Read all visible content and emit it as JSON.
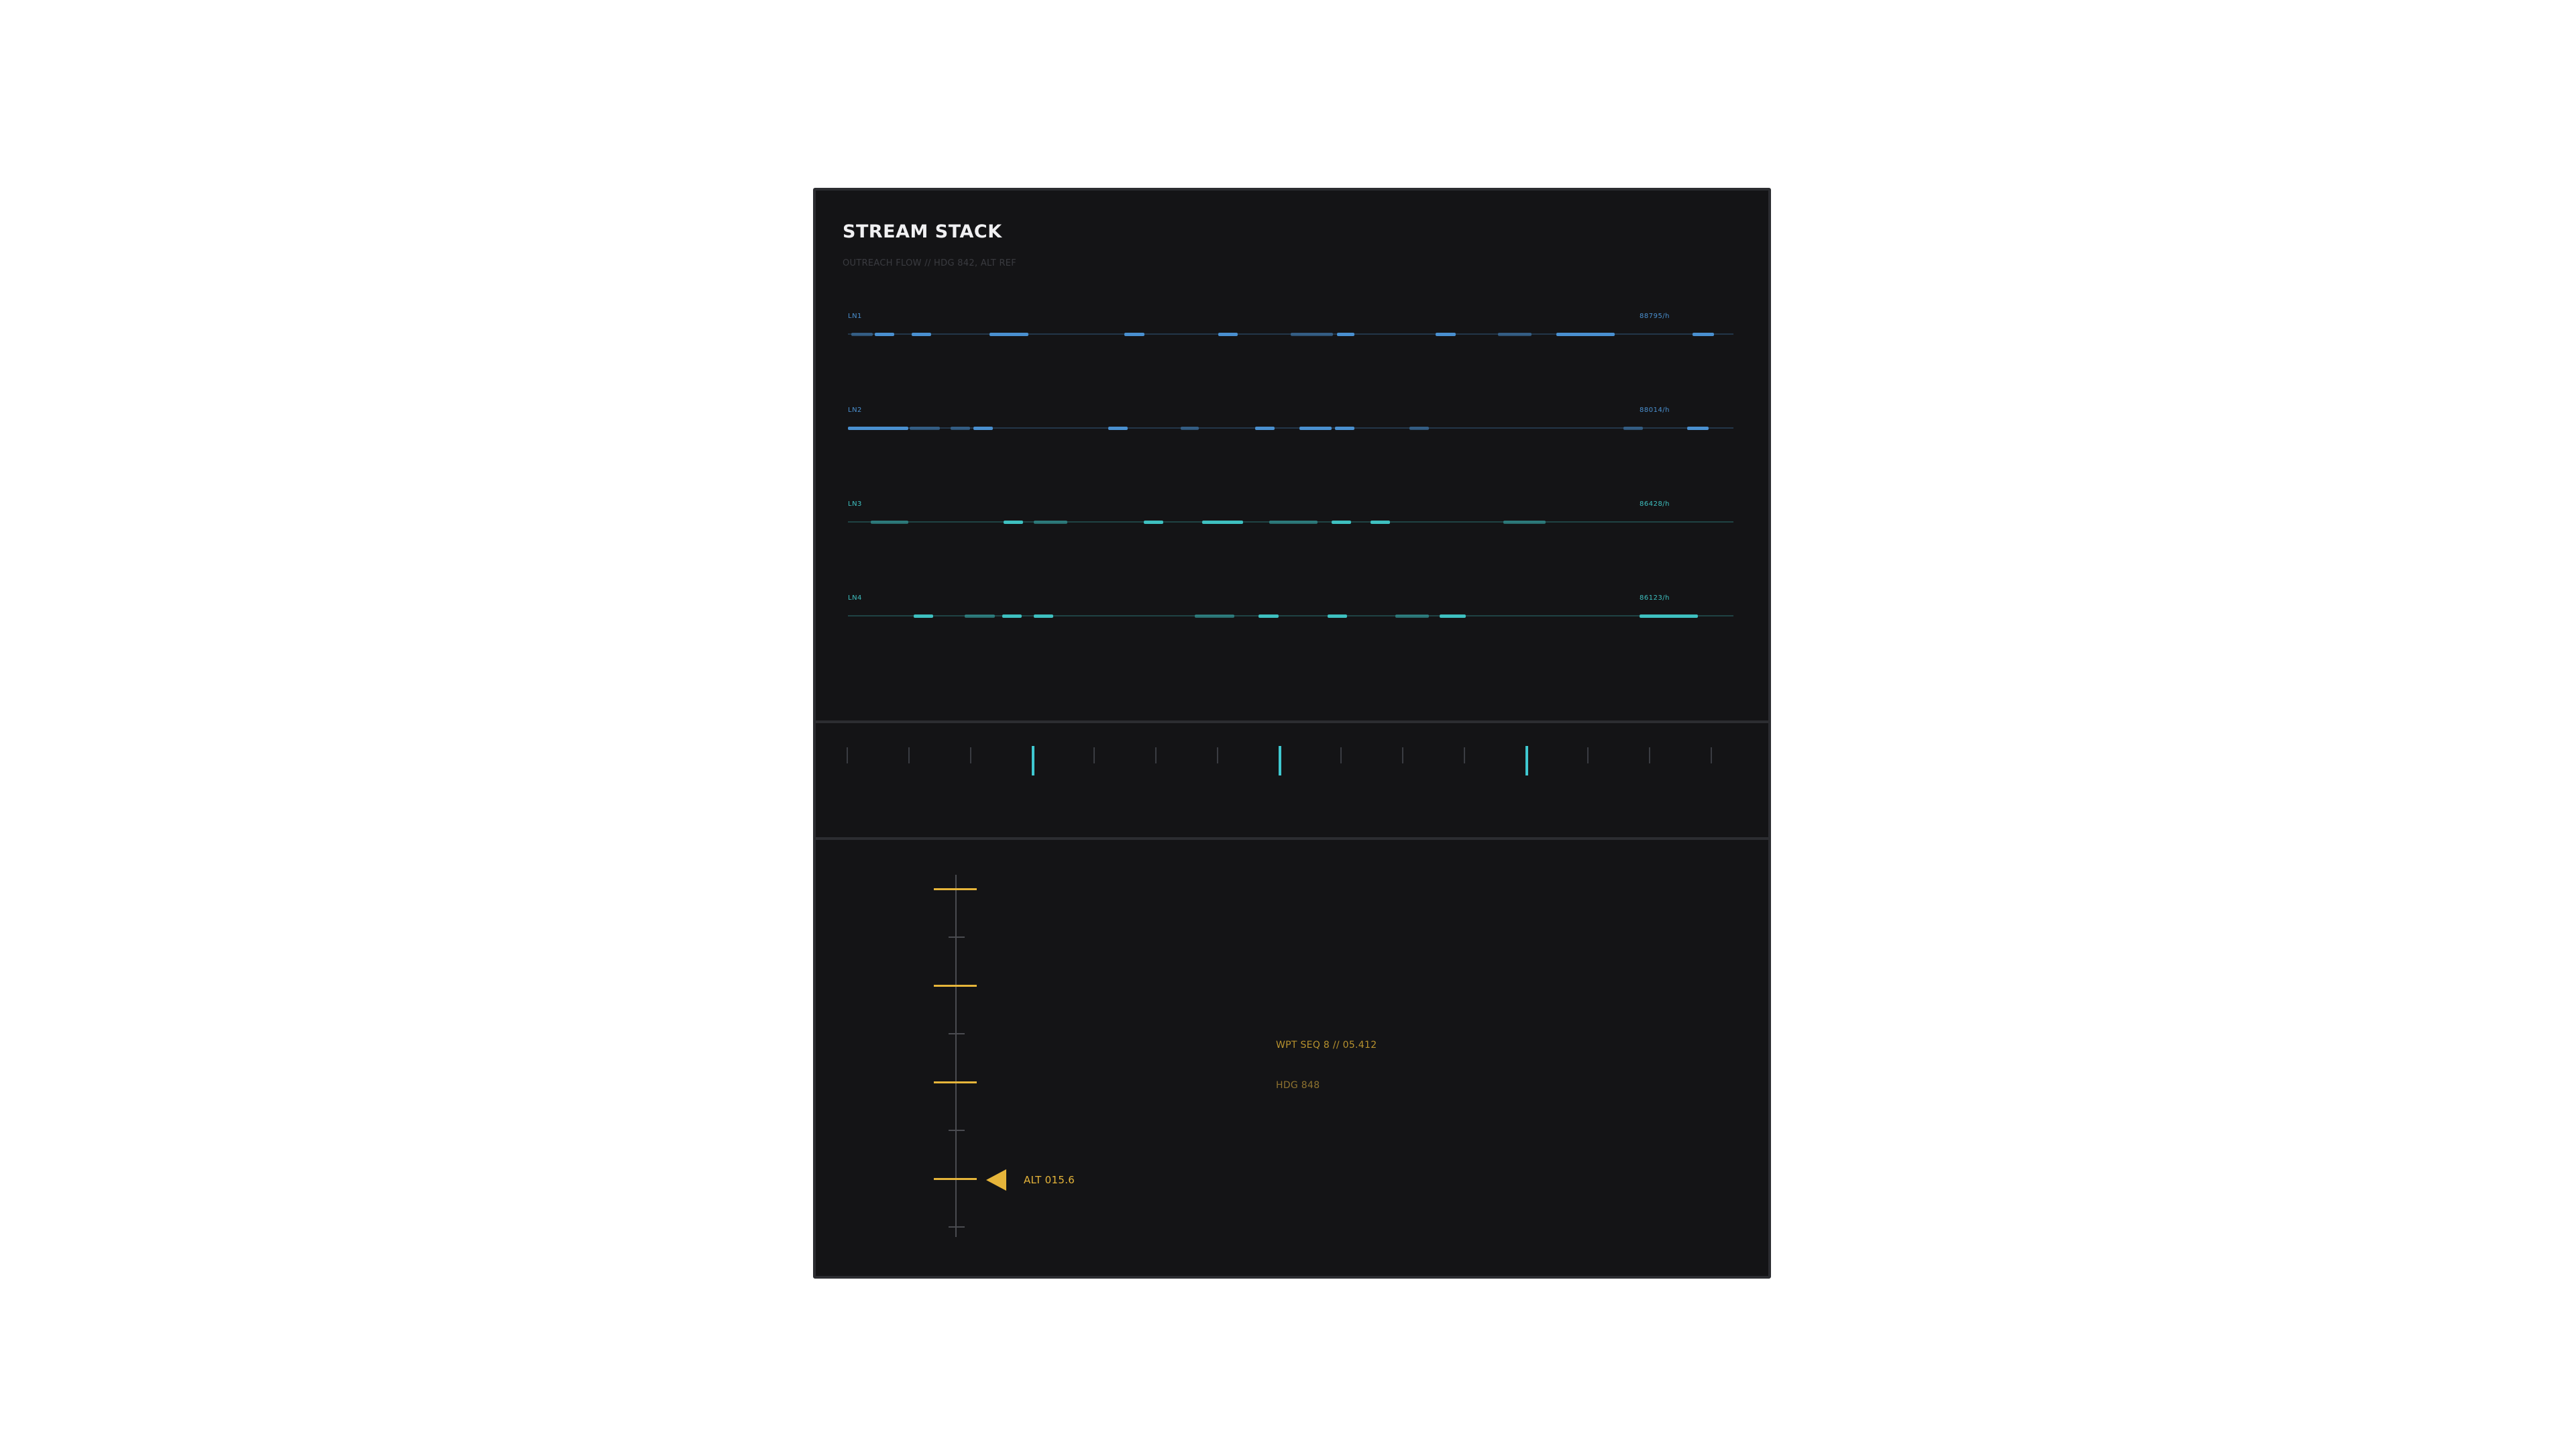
{
  "header": {
    "title": "STREAM STACK",
    "subtitle": "OUTREACH FLOW // HDG 842, ALT REF"
  },
  "colors": {
    "panel_bg": "#141416",
    "blue": "#4a90d0",
    "teal": "#3ec0c0",
    "amber": "#e6b53a"
  },
  "lanes": [
    {
      "label": "LN1",
      "rate": "88795/h",
      "color": "#4a90d0",
      "segments": [
        {
          "start": 0.004,
          "end": 0.028,
          "dim": true
        },
        {
          "start": 0.03,
          "end": 0.052,
          "dim": false
        },
        {
          "start": 0.072,
          "end": 0.094,
          "dim": false
        },
        {
          "start": 0.16,
          "end": 0.204,
          "dim": false
        },
        {
          "start": 0.312,
          "end": 0.335,
          "dim": false
        },
        {
          "start": 0.418,
          "end": 0.44,
          "dim": false
        },
        {
          "start": 0.5,
          "end": 0.548,
          "dim": true
        },
        {
          "start": 0.552,
          "end": 0.572,
          "dim": false
        },
        {
          "start": 0.664,
          "end": 0.686,
          "dim": false
        },
        {
          "start": 0.734,
          "end": 0.772,
          "dim": true
        },
        {
          "start": 0.8,
          "end": 0.866,
          "dim": false
        },
        {
          "start": 0.954,
          "end": 0.978,
          "dim": false
        }
      ]
    },
    {
      "label": "LN2",
      "rate": "88014/h",
      "color": "#4a90d0",
      "segments": [
        {
          "start": 0.0,
          "end": 0.068,
          "dim": false
        },
        {
          "start": 0.07,
          "end": 0.104,
          "dim": true
        },
        {
          "start": 0.116,
          "end": 0.138,
          "dim": true
        },
        {
          "start": 0.142,
          "end": 0.164,
          "dim": false
        },
        {
          "start": 0.294,
          "end": 0.316,
          "dim": false
        },
        {
          "start": 0.376,
          "end": 0.396,
          "dim": true
        },
        {
          "start": 0.46,
          "end": 0.482,
          "dim": false
        },
        {
          "start": 0.51,
          "end": 0.546,
          "dim": false
        },
        {
          "start": 0.55,
          "end": 0.572,
          "dim": false
        },
        {
          "start": 0.634,
          "end": 0.656,
          "dim": true
        },
        {
          "start": 0.876,
          "end": 0.898,
          "dim": true
        },
        {
          "start": 0.948,
          "end": 0.972,
          "dim": false
        }
      ]
    },
    {
      "label": "LN3",
      "rate": "86428/h",
      "color": "#3ec0c0",
      "segments": [
        {
          "start": 0.026,
          "end": 0.068,
          "dim": true
        },
        {
          "start": 0.176,
          "end": 0.198,
          "dim": false
        },
        {
          "start": 0.21,
          "end": 0.248,
          "dim": true
        },
        {
          "start": 0.334,
          "end": 0.356,
          "dim": false
        },
        {
          "start": 0.4,
          "end": 0.446,
          "dim": false
        },
        {
          "start": 0.476,
          "end": 0.53,
          "dim": true
        },
        {
          "start": 0.546,
          "end": 0.568,
          "dim": false
        },
        {
          "start": 0.59,
          "end": 0.612,
          "dim": false
        },
        {
          "start": 0.74,
          "end": 0.788,
          "dim": true
        }
      ]
    },
    {
      "label": "LN4",
      "rate": "86123/h",
      "color": "#3ec0c0",
      "segments": [
        {
          "start": 0.074,
          "end": 0.096,
          "dim": false
        },
        {
          "start": 0.132,
          "end": 0.166,
          "dim": true
        },
        {
          "start": 0.174,
          "end": 0.196,
          "dim": false
        },
        {
          "start": 0.21,
          "end": 0.232,
          "dim": false
        },
        {
          "start": 0.392,
          "end": 0.436,
          "dim": true
        },
        {
          "start": 0.464,
          "end": 0.486,
          "dim": false
        },
        {
          "start": 0.542,
          "end": 0.564,
          "dim": false
        },
        {
          "start": 0.618,
          "end": 0.656,
          "dim": true
        },
        {
          "start": 0.668,
          "end": 0.698,
          "dim": false
        },
        {
          "start": 0.894,
          "end": 0.96,
          "dim": false
        }
      ]
    }
  ],
  "ruler": {
    "tick_count": 15,
    "major_ticks": [
      3,
      7,
      11
    ]
  },
  "altitude": {
    "major_levels": 4,
    "current_level_index": 3,
    "readout": "ALT 015.6"
  },
  "waypoint": {
    "sequence": "WPT SEQ 8 // 05.412",
    "heading": "HDG 848"
  }
}
